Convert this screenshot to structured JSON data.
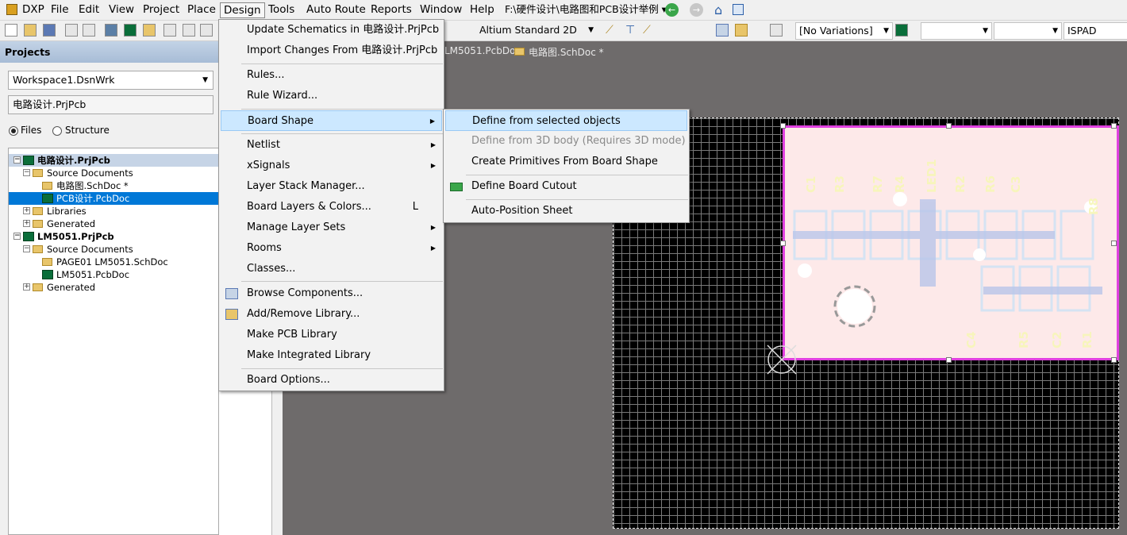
{
  "menubar": {
    "dxp": "DXP",
    "file": "File",
    "edit": "Edit",
    "view": "View",
    "project": "Project",
    "place": "Place",
    "design": "Design",
    "tools": "Tools",
    "auto_route": "Auto Route",
    "reports": "Reports",
    "window": "Window",
    "help": "Help",
    "path": "F:\\硬件设计\\电路图和PCB设计举例"
  },
  "toolbar": {
    "view_mode": "Altium Standard 2D",
    "variations": "[No Variations]",
    "ispad": "ISPAD"
  },
  "projects_panel": {
    "title": "Projects",
    "workspace": "Workspace1.DsnWrk",
    "project_field": "电路设计.PrjPcb",
    "radio_files": "Files",
    "radio_structure": "Structure",
    "tree": [
      "电路设计.PrjPcb",
      "Source Documents",
      "电路图.SchDoc *",
      "PCB设计.PcbDoc",
      "Libraries",
      "Generated",
      "LM5051.PrjPcb",
      "Source Documents",
      "PAGE01 LM5051.SchDoc",
      "LM5051.PcbDoc",
      "Generated"
    ]
  },
  "tabs": [
    "LM5051.PcbDoc",
    "电路图.SchDoc *"
  ],
  "design_menu": {
    "items": [
      "Update Schematics in 电路设计.PrjPcb",
      "Import Changes From 电路设计.PrjPcb",
      "Rules...",
      "Rule Wizard...",
      "Board Shape",
      "Netlist",
      "xSignals",
      "Layer Stack Manager...",
      "Board Layers & Colors...",
      "Manage Layer Sets",
      "Rooms",
      "Classes...",
      "Browse Components...",
      "Add/Remove Library...",
      "Make PCB Library",
      "Make Integrated Library",
      "Board Options..."
    ],
    "shortcut_layers": "L"
  },
  "board_shape_submenu": {
    "items": [
      "Define from selected objects",
      "Define from 3D body (Requires 3D mode)",
      "Create Primitives From Board Shape",
      "Define Board Cutout",
      "Auto-Position Sheet"
    ]
  },
  "pcb": {
    "designators": [
      "C1",
      "R3",
      "R7",
      "R4",
      "LED1",
      "R2",
      "R6",
      "C3",
      "R8",
      "C4",
      "R5",
      "C2",
      "R1"
    ]
  }
}
